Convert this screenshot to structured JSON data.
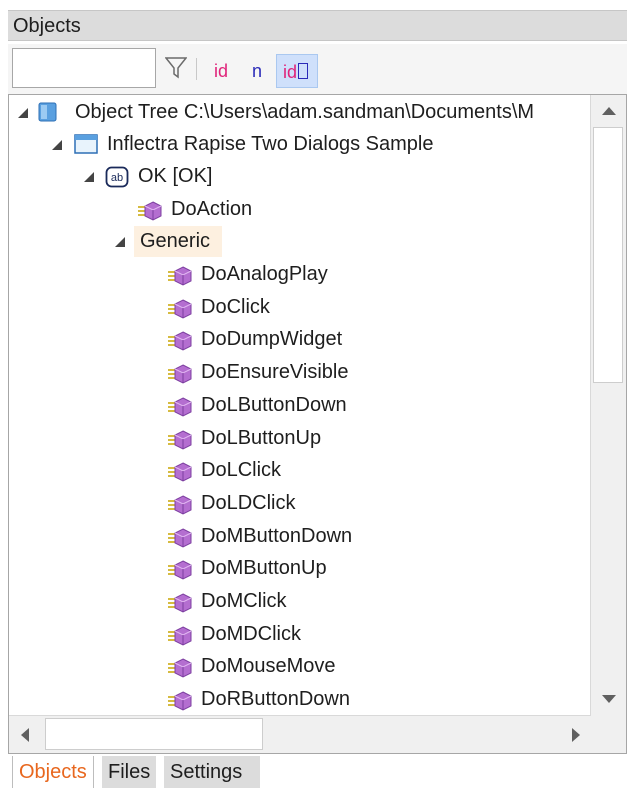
{
  "panel": {
    "title": "Objects"
  },
  "toolbar": {
    "search_value": "",
    "filter_icon": "filter-funnel-icon",
    "btn_id": "id",
    "btn_n": "n",
    "btn_id_locator": "id"
  },
  "tree": {
    "root": "Object Tree C:\\Users\\adam.sandman\\Documents\\M",
    "dialog": "Inflectra Rapise Two Dialogs Sample",
    "button": "OK [OK]",
    "button_action": "DoAction",
    "group": "Generic",
    "actions": [
      "DoAnalogPlay",
      "DoClick",
      "DoDumpWidget",
      "DoEnsureVisible",
      "DoLButtonDown",
      "DoLButtonUp",
      "DoLClick",
      "DoLDClick",
      "DoMButtonDown",
      "DoMButtonUp",
      "DoMClick",
      "DoMDClick",
      "DoMouseMove",
      "DoRButtonDown"
    ]
  },
  "tabs": {
    "objects": "Objects",
    "files": "Files",
    "settings": "Settings",
    "active": "Objects"
  },
  "colors": {
    "active_tab": "#e8671e",
    "method_icon": "#b46ed0",
    "generic_highlight": "#fdf0e0"
  }
}
